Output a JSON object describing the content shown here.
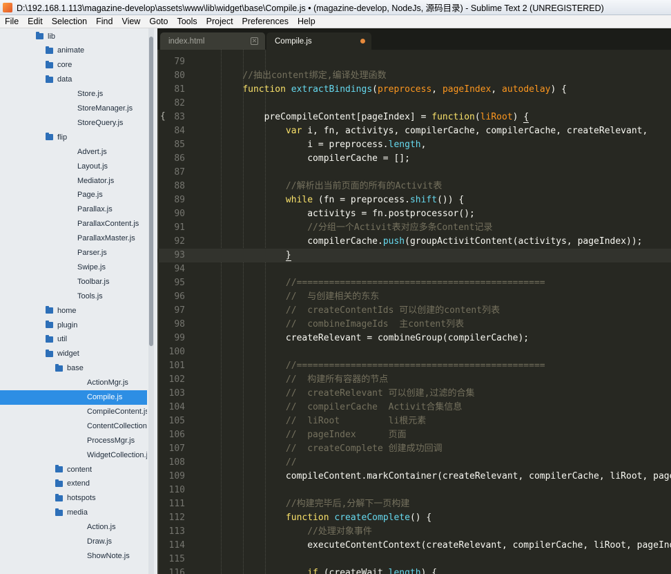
{
  "window": {
    "title": "D:\\192.168.1.113\\magazine-develop\\assets\\www\\lib\\widget\\base\\Compile.js • (magazine-develop, NodeJs, 源码目录) - Sublime Text 2 (UNREGISTERED)"
  },
  "menubar": [
    "File",
    "Edit",
    "Selection",
    "Find",
    "View",
    "Goto",
    "Tools",
    "Project",
    "Preferences",
    "Help"
  ],
  "sidebar": [
    {
      "label": "lib",
      "type": "folder",
      "level": 0
    },
    {
      "label": "animate",
      "type": "folder",
      "level": 1
    },
    {
      "label": "core",
      "type": "folder",
      "level": 1
    },
    {
      "label": "data",
      "type": "folder",
      "level": 1
    },
    {
      "label": "Store.js",
      "type": "file",
      "level": 2
    },
    {
      "label": "StoreManager.js",
      "type": "file",
      "level": 2
    },
    {
      "label": "StoreQuery.js",
      "type": "file",
      "level": 2
    },
    {
      "label": "flip",
      "type": "folder",
      "level": 1
    },
    {
      "label": "Advert.js",
      "type": "file",
      "level": 2
    },
    {
      "label": "Layout.js",
      "type": "file",
      "level": 2
    },
    {
      "label": "Mediator.js",
      "type": "file",
      "level": 2
    },
    {
      "label": "Page.js",
      "type": "file",
      "level": 2
    },
    {
      "label": "Parallax.js",
      "type": "file",
      "level": 2
    },
    {
      "label": "ParallaxContent.js",
      "type": "file",
      "level": 2
    },
    {
      "label": "ParallaxMaster.js",
      "type": "file",
      "level": 2
    },
    {
      "label": "Parser.js",
      "type": "file",
      "level": 2
    },
    {
      "label": "Swipe.js",
      "type": "file",
      "level": 2
    },
    {
      "label": "Toolbar.js",
      "type": "file",
      "level": 2
    },
    {
      "label": "Tools.js",
      "type": "file",
      "level": 2
    },
    {
      "label": "home",
      "type": "folder",
      "level": 1
    },
    {
      "label": "plugin",
      "type": "folder",
      "level": 1
    },
    {
      "label": "util",
      "type": "folder",
      "level": 1
    },
    {
      "label": "widget",
      "type": "folder",
      "level": 1
    },
    {
      "label": "base",
      "type": "folder",
      "level": 2
    },
    {
      "label": "ActionMgr.js",
      "type": "file",
      "level": 3
    },
    {
      "label": "Compile.js",
      "type": "file",
      "level": 3,
      "selected": true
    },
    {
      "label": "CompileContent.js",
      "type": "file",
      "level": 3
    },
    {
      "label": "ContentCollection.j",
      "type": "file",
      "level": 3
    },
    {
      "label": "ProcessMgr.js",
      "type": "file",
      "level": 3
    },
    {
      "label": "WidgetCollection.js",
      "type": "file",
      "level": 3
    },
    {
      "label": "content",
      "type": "folder",
      "level": 2
    },
    {
      "label": "extend",
      "type": "folder",
      "level": 2
    },
    {
      "label": "hotspots",
      "type": "folder",
      "level": 2
    },
    {
      "label": "media",
      "type": "folder",
      "level": 2
    },
    {
      "label": "Action.js",
      "type": "file",
      "level": 3
    },
    {
      "label": "Draw.js",
      "type": "file",
      "level": 3
    },
    {
      "label": "ShowNote.js",
      "type": "file",
      "level": 3
    }
  ],
  "tabs": [
    {
      "label": "index.html",
      "active": false,
      "dirty": false
    },
    {
      "label": "Compile.js",
      "active": true,
      "dirty": true
    }
  ],
  "editor": {
    "fold_marker": "{",
    "active_line": 93,
    "lines": [
      {
        "n": "79",
        "tokens": []
      },
      {
        "n": "80",
        "tokens": [
          [
            "    //抽出content绑定,编译处理函数",
            "cm"
          ]
        ]
      },
      {
        "n": "81",
        "tokens": [
          [
            "    ",
            ""
          ],
          [
            "function",
            "kw"
          ],
          [
            " ",
            ""
          ],
          [
            "extractBindings",
            "fn"
          ],
          [
            "(",
            ""
          ],
          [
            "preprocess",
            "pr"
          ],
          [
            ", ",
            ""
          ],
          [
            "pageIndex",
            "pr"
          ],
          [
            ", ",
            ""
          ],
          [
            "autodelay",
            "pr"
          ],
          [
            ") {",
            ""
          ]
        ]
      },
      {
        "n": "82",
        "tokens": []
      },
      {
        "n": "83",
        "tokens": [
          [
            "        preCompileContent[pageIndex] = ",
            ""
          ],
          [
            "function",
            "kw"
          ],
          [
            "(",
            ""
          ],
          [
            "liRoot",
            "pr"
          ],
          [
            ") ",
            ""
          ],
          [
            "{",
            "ul"
          ]
        ]
      },
      {
        "n": "84",
        "tokens": [
          [
            "            ",
            ""
          ],
          [
            "var",
            "kw"
          ],
          [
            " i, fn, activitys, compilerCache, compilerCache, createRelevant,",
            ""
          ]
        ]
      },
      {
        "n": "85",
        "tokens": [
          [
            "                i = preprocess.",
            ""
          ],
          [
            "length",
            "fn"
          ],
          [
            ",",
            ""
          ]
        ]
      },
      {
        "n": "86",
        "tokens": [
          [
            "                compilerCache = [];",
            ""
          ]
        ]
      },
      {
        "n": "87",
        "tokens": []
      },
      {
        "n": "88",
        "tokens": [
          [
            "            //解析出当前页面的所有的Activit表",
            "cm"
          ]
        ]
      },
      {
        "n": "89",
        "tokens": [
          [
            "            ",
            ""
          ],
          [
            "while",
            "kw"
          ],
          [
            " (fn = preprocess.",
            ""
          ],
          [
            "shift",
            "fn"
          ],
          [
            "()) {",
            ""
          ]
        ]
      },
      {
        "n": "90",
        "tokens": [
          [
            "                activitys = fn.postprocessor();",
            ""
          ]
        ]
      },
      {
        "n": "91",
        "tokens": [
          [
            "                //分组一个Activit表对应多条Content记录",
            "cm"
          ]
        ]
      },
      {
        "n": "92",
        "tokens": [
          [
            "                compilerCache.",
            ""
          ],
          [
            "push",
            "fn"
          ],
          [
            "(groupActivitContent(activitys, pageIndex));",
            ""
          ]
        ]
      },
      {
        "n": "93",
        "tokens": [
          [
            "            ",
            ""
          ],
          [
            "}",
            "ul"
          ]
        ]
      },
      {
        "n": "94",
        "tokens": []
      },
      {
        "n": "95",
        "tokens": [
          [
            "            //==============================================",
            "cm"
          ]
        ]
      },
      {
        "n": "96",
        "tokens": [
          [
            "            //  与创建相关的东东",
            "cm"
          ]
        ]
      },
      {
        "n": "97",
        "tokens": [
          [
            "            //  createContentIds 可以创建的content列表",
            "cm"
          ]
        ]
      },
      {
        "n": "98",
        "tokens": [
          [
            "            //  combineImageIds  主content列表",
            "cm"
          ]
        ]
      },
      {
        "n": "99",
        "tokens": [
          [
            "            createRelevant = combineGroup(compilerCache);",
            ""
          ]
        ]
      },
      {
        "n": "100",
        "tokens": []
      },
      {
        "n": "101",
        "tokens": [
          [
            "            //==============================================",
            "cm"
          ]
        ]
      },
      {
        "n": "102",
        "tokens": [
          [
            "            //  构建所有容器的节点",
            "cm"
          ]
        ]
      },
      {
        "n": "103",
        "tokens": [
          [
            "            //  createRelevant 可以创建,过滤的合集",
            "cm"
          ]
        ]
      },
      {
        "n": "104",
        "tokens": [
          [
            "            //  compilerCache  Activit合集信息",
            "cm"
          ]
        ]
      },
      {
        "n": "105",
        "tokens": [
          [
            "            //  liRoot         li根元素",
            "cm"
          ]
        ]
      },
      {
        "n": "106",
        "tokens": [
          [
            "            //  pageIndex      页面",
            "cm"
          ]
        ]
      },
      {
        "n": "107",
        "tokens": [
          [
            "            //  createComplete 创建成功回调",
            "cm"
          ]
        ]
      },
      {
        "n": "108",
        "tokens": [
          [
            "            //",
            "cm"
          ]
        ]
      },
      {
        "n": "109",
        "tokens": [
          [
            "            compileContent.markContainer(createRelevant, compilerCache, liRoot, pageIn",
            ""
          ]
        ]
      },
      {
        "n": "110",
        "tokens": []
      },
      {
        "n": "111",
        "tokens": [
          [
            "            //构建完毕后,分解下一页构建",
            "cm"
          ]
        ]
      },
      {
        "n": "112",
        "tokens": [
          [
            "            ",
            ""
          ],
          [
            "function",
            "kw"
          ],
          [
            " ",
            ""
          ],
          [
            "createComplete",
            "fn"
          ],
          [
            "() {",
            ""
          ]
        ]
      },
      {
        "n": "113",
        "tokens": [
          [
            "                //处理对象事件",
            "cm"
          ]
        ]
      },
      {
        "n": "114",
        "tokens": [
          [
            "                executeContentContext(createRelevant, compilerCache, liRoot, pageIndex",
            ""
          ]
        ]
      },
      {
        "n": "115",
        "tokens": []
      },
      {
        "n": "116",
        "tokens": [
          [
            "                ",
            ""
          ],
          [
            "if",
            "kw"
          ],
          [
            " (createWait.",
            ""
          ],
          [
            "length",
            "fn"
          ],
          [
            ") {",
            ""
          ]
        ]
      }
    ]
  }
}
